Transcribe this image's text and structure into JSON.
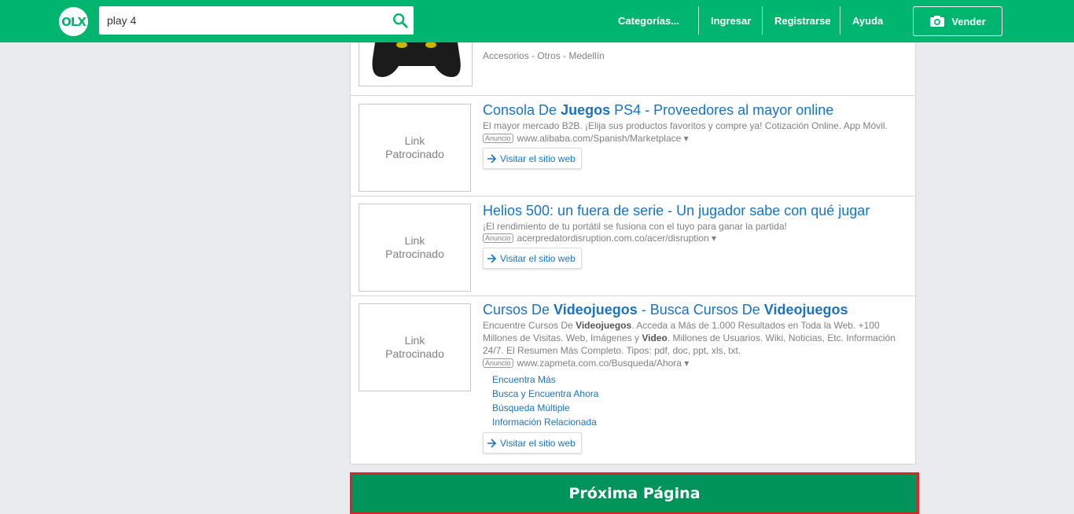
{
  "header": {
    "logo_text": "OLX",
    "search_value": "play 4",
    "nav": [
      "Categorías...",
      "Ingresar",
      "Registrarse",
      "Ayuda"
    ],
    "sell_label": "Vender",
    "brand_color": "#00b56d"
  },
  "top_listing": {
    "meta": "Accesorios - Otros - Medellín"
  },
  "ads": [
    {
      "thumb_line1": "Link",
      "thumb_line2": "Patrocinado",
      "title_a": "Consola De ",
      "title_b": "Juegos",
      "title_c": " PS4 - Proveedores al mayor online",
      "desc": "El mayor mercado B2B. ¡Elija sus productos favoritos y compre ya! Cotización Online. App Móvil.",
      "badge": "Anuncio",
      "url": "www.alibaba.com/Spanish/Marketplace ▾",
      "visit": "Visitar el sitio web"
    },
    {
      "thumb_line1": "Link",
      "thumb_line2": "Patrocinado",
      "title": "Helios 500: un fuera de serie - Un jugador sabe con qué jugar",
      "desc": "¡El rendimiento de tu portátil se fusiona con el tuyo para ganar la partida!",
      "badge": "Anuncio",
      "url": "acerpredatordisruption.com.co/acer/disruption ▾",
      "visit": "Visitar el sitio web"
    },
    {
      "thumb_line1": "Link",
      "thumb_line2": "Patrocinado",
      "title_a": "Cursos De ",
      "title_b": "Videojuegos",
      "title_c": " - Busca Cursos De ",
      "title_d": "Videojuegos",
      "desc_a": "Encuentre Cursos De ",
      "desc_b": "Videojuegos",
      "desc_c": ". Acceda a Más de 1.000 Resultados en Toda la Web. +100 Millones de Visitas. Web, Imágenes y ",
      "desc_d": "Video",
      "desc_e": ". Millones de Usuarios. Wiki, Noticias, Etc. Información 24/7. El Resumen Más Completo. Tipos: pdf, doc, ppt, xls, txt.",
      "badge": "Anuncio",
      "url": "www.zapmeta.com.co/Busqueda/Ahora ▾",
      "sublinks": [
        "Encuentra Más",
        "Busca y Encuentra Ahora",
        "Búsqueda Múltiple",
        "Información Relacionada"
      ],
      "visit": "Visitar el sitio web"
    }
  ],
  "next_page": "Próxima Página"
}
